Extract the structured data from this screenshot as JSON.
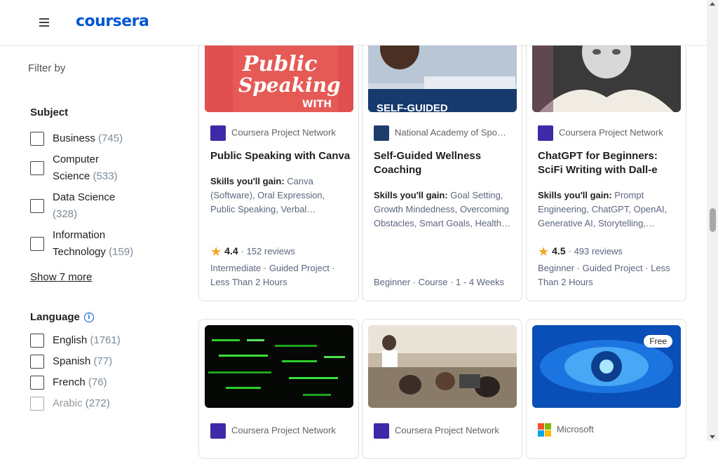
{
  "header": {
    "logo_text": "coursera"
  },
  "sidebar": {
    "filter_by": "Filter by",
    "subject_title": "Subject",
    "subject_options": [
      {
        "label": "Business",
        "count": "(745)"
      },
      {
        "label": "Computer Science",
        "count": "(533)"
      },
      {
        "label": "Data Science",
        "count": "(328)"
      },
      {
        "label": "Information Technology",
        "count": "(159)"
      }
    ],
    "show_more": "Show 7 more",
    "language_title": "Language",
    "info_icon_glyph": "i",
    "language_options": [
      {
        "label": "English",
        "count": "(1761)"
      },
      {
        "label": "Spanish",
        "count": "(77)"
      },
      {
        "label": "French",
        "count": "(76)"
      },
      {
        "label": "Arabic",
        "count": "(272)"
      }
    ]
  },
  "cards": [
    {
      "partner": "Coursera Project Network",
      "title": "Public Speaking with Canva",
      "skills_label": "Skills you'll gain:",
      "skills": "Canva (Software), Oral Expression, Public Speaking, Verbal…",
      "rating": "4.4",
      "reviews": "152 reviews",
      "meta": "Intermediate · Guided Project · Less Than 2 Hours"
    },
    {
      "partner": "National Academy of Spo…",
      "title": "Self-Guided Wellness Coaching",
      "skills_label": "Skills you'll gain:",
      "skills": "Goal Setting, Growth Mindedness, Overcoming Obstacles, Smart Goals, Health…",
      "meta": "Beginner · Course · 1 - 4 Weeks"
    },
    {
      "partner": "Coursera Project Network",
      "title": "ChatGPT for Beginners: SciFi Writing with Dall-e",
      "skills_label": "Skills you'll gain:",
      "skills": "Prompt Engineering, ChatGPT, OpenAI, Generative AI, Storytelling,…",
      "rating": "4.5",
      "reviews": "493 reviews",
      "meta": "Beginner · Guided Project · Less Than 2 Hours"
    },
    {
      "partner": "Coursera Project Network"
    },
    {
      "partner": "Coursera Project Network"
    },
    {
      "partner": "Microsoft",
      "badge": "Free"
    }
  ],
  "thumb_text": {
    "card1_line1": "Public",
    "card1_line2": "Speaking",
    "card1_line3": "WITH",
    "card2_text": "SELF-GUIDED"
  },
  "colors": {
    "accent": "#0056d2",
    "star": "#f5a623",
    "partner_logo": "#3c2aa8"
  }
}
